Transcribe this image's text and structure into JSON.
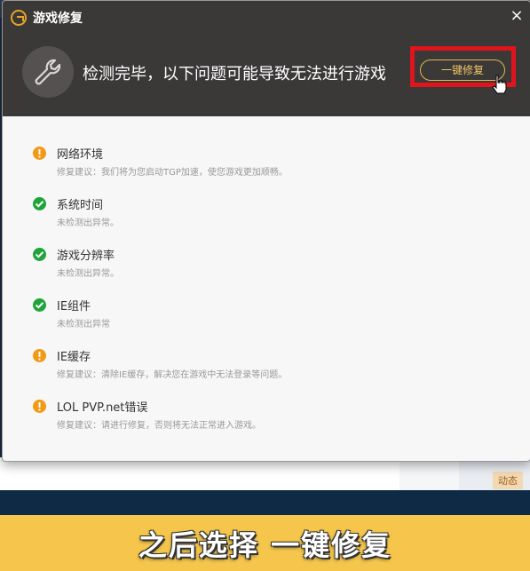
{
  "dialog": {
    "title": "游戏修复",
    "close_glyph": "×",
    "status_message": "检测完毕，以下问题可能导致无法进行游戏",
    "repair_button_label": "一键修复"
  },
  "items": [
    {
      "name": "网络环境",
      "detail": "修复建议：我们将为您启动TGP加速，使您游戏更加顺畅。",
      "status": "warning"
    },
    {
      "name": "系统时间",
      "detail": "未检测出异常。",
      "status": "ok"
    },
    {
      "name": "游戏分辨率",
      "detail": "未检测出异常。",
      "status": "ok"
    },
    {
      "name": "IE组件",
      "detail": "未检测出异常",
      "status": "ok"
    },
    {
      "name": "IE缓存",
      "detail": "修复建议：清除IE缓存，解决您在游戏中无法登录等问题。",
      "status": "warning"
    },
    {
      "name": "LOL PVP.net错误",
      "detail": "修复建议：请进行修复，否则将无法正常进入游戏。",
      "status": "warning"
    }
  ],
  "background": {
    "badge_label": "动态"
  },
  "caption": "之后选择 一键修复",
  "colors": {
    "header_bg": "#3b3838",
    "accent_gold": "#e7b74a",
    "highlight_red": "#e0141c",
    "warning": "#f29a14",
    "ok": "#1fa43a",
    "caption_bg": "#f5c64b"
  }
}
